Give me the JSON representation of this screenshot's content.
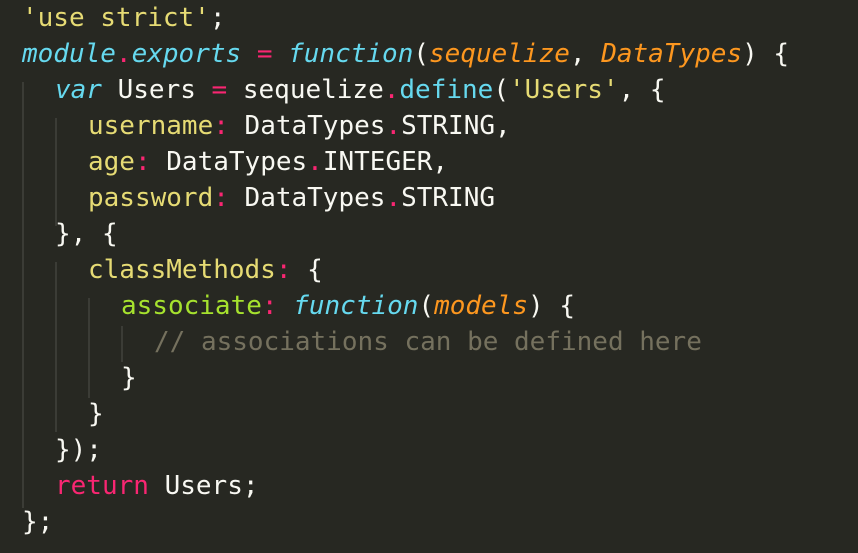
{
  "colors": {
    "background": "#272822",
    "default": "#F8F8F2",
    "string": "#E6DB74",
    "keyword": "#F92672",
    "storage": "#66D9EF",
    "function_name": "#A6E22E",
    "parameter": "#FD971F",
    "comment": "#75715E",
    "indent_guide": "#3b3c36"
  },
  "code": {
    "line1": {
      "t0": "'use strict'",
      "t1": ";"
    },
    "line2": {
      "t0": "module",
      "t1": ".",
      "t2": "exports",
      "t3": " ",
      "t4": "=",
      "t5": " ",
      "t6": "function",
      "t7": "(",
      "t8": "sequelize",
      "t9": ", ",
      "t10": "DataTypes",
      "t11": ") {"
    },
    "line3": {
      "t0": "var",
      "t1": " Users ",
      "t2": "=",
      "t3": " sequelize",
      "t4": ".",
      "t5": "define",
      "t6": "(",
      "t7": "'Users'",
      "t8": ", {"
    },
    "line4": {
      "t0": "username",
      "t1": ":",
      "t2": " DataTypes",
      "t3": ".",
      "t4": "STRING",
      "t5": ","
    },
    "line5": {
      "t0": "age",
      "t1": ":",
      "t2": " DataTypes",
      "t3": ".",
      "t4": "INTEGER",
      "t5": ","
    },
    "line6": {
      "t0": "password",
      "t1": ":",
      "t2": " DataTypes",
      "t3": ".",
      "t4": "STRING"
    },
    "line7": {
      "t0": "}, {"
    },
    "line8": {
      "t0": "classMethods",
      "t1": ":",
      "t2": " {"
    },
    "line9": {
      "t0": "associate",
      "t1": ":",
      "t2": " ",
      "t3": "function",
      "t4": "(",
      "t5": "models",
      "t6": ") {"
    },
    "line10": {
      "t0": "// associations can be defined here"
    },
    "line11": {
      "t0": "}"
    },
    "line12": {
      "t0": "}"
    },
    "line13": {
      "t0": "});"
    },
    "line14": {
      "t0": "return",
      "t1": " Users;"
    },
    "line15": {
      "t0": "};"
    }
  }
}
